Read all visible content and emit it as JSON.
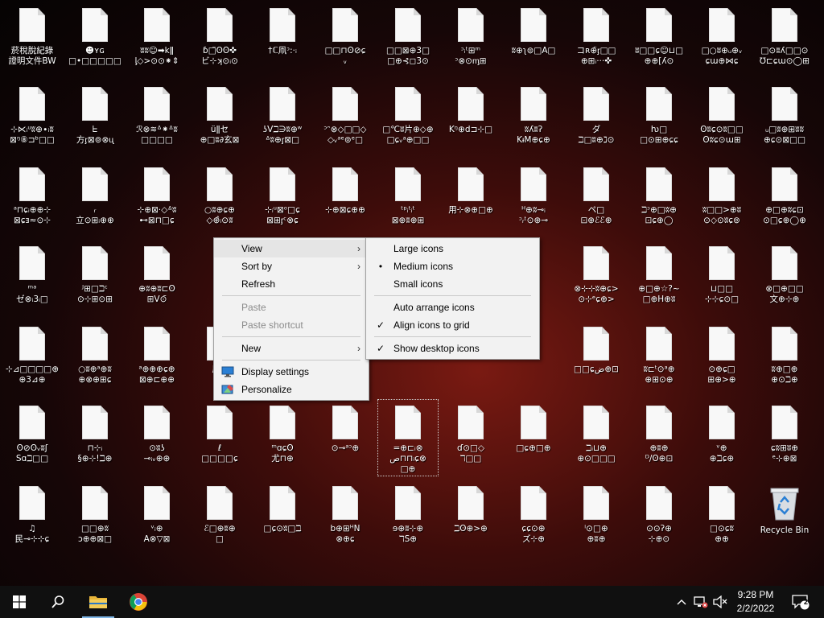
{
  "desktop": {
    "icons": [
      [
        "菸稅脫紀錄\n證明文件BW",
        "☻ʏɢ\n□•□□□□□",
        "ʬʬ☺➡kǁ\nᶅ◇>⊙⊙⁕⇕",
        "ɓ□̈ʘ̄ʘ̃✜\nビ⊹ʞ⊙ᵢ⊙",
        "†ℂ凧ᵓ:⋅ᵢ",
        "□□⊓ʘ̆⊘ɕ\nᵥ",
        "□□⊠⊕3□\n□⊕⊰◻3⊙",
        "ᵓᵢᵗ⊞ᵐ\nᵓ⊗⊙ᶆ⊞",
        "ʬ⊕ʅ⊜□A□",
        "コʀ⊕̈ᶉ□□\n⊕⊞ᵢ⋅⋅⋅✜",
        "ʬ□□ɕ☺⊔□\n⊕⊕[ʎ⊙",
        "□○ʬ⊕ᵤ⊕ᵥ\nɕɯ⊕⋈ɕ",
        "□⊙ʬʎ□□⊙\n℧⊏ɕɯ⊙◯⊞"
      ],
      [
        "⊹⋉ᵢᵘʬ⊕∙ᵢʬ\n⊠ᵑ⑧⊐ᵇ□□",
        "ᖶ\n方ᶉ⊠⊚⊗ᶙ",
        "ℛ⊗≋ᐞ⁕ᐞʬ\n□□□□",
        "ǖǁセ\n⊕□ʬ∂玄⊠",
        "ʖVℶ∋ʬ⊕ʷ\nᐞʬ⊕ᶉ⊠□",
        "ᵓᵔ⊗◇□□◇\n◇ᵥᵃᵉ⊚ᵉ□",
        "□℃ʬ片⊕◇⊕\n□ɕᵥᵃ⊕□□",
        "Kᵑ⊕d⊐⊹□",
        "ʬʎʬʔ\nKᵼM⊕ɕ⊕",
        "ダ\nℶ□ʬ⊕ℷ⊙",
        "ƕ□\n□⊙⊞⊕ɕɕ",
        "ʘʬɕ⊙ʬ□□\nʘʬɕ⊙ɯ⊞",
        "ᵤ□ʬ⊕⊞ʬʬ\n⊕ɕ⊙⊠□□"
      ],
      [
        "ᵃ⊓ɕᵢ⊕⊕⊹\n⊠ɕⱻ≈⊙⊹",
        "ᵣ\n立⊙⊞ᵢ⊕⊕",
        "⊹⊕⊠⋅◇ᐞʬ\n⊷⊠⊓□ɕ",
        "○ʬ⊕ɕ⊕\n◇⊕̂ᵢ⊙ʬ",
        "⊹ᵢᵘ⊠ᵒ□ɕ\n⊠⊞ᶉᶜ⊗ɕ",
        "⊹⊕⊠ɕ⊕⊕",
        "ᵗᵖᵢᵗᵢᵗ\n⊠⊕ʬ⊕⊞",
        "用⊹⊗⊕□⊕",
        "ᴴ⊕ʬ⊸ᵢ\nᵓᵣᵗ⊙⊕⊸",
        "ペ□\n⊡⊕ℰℰ⊕",
        "ℶᵓ⊕□ʬ⊕\n⊡ɕ⊕◯",
        "ʬ□□>⊕ʬ\n⊙◇⊙ʬɕ⊚",
        "⊕□⊕ʬɕ⊡\n⊙□ɕ⊕◯⊕"
      ],
      [
        "ᵐᵃ\nゼ⊗ᵢ3ᵢ□",
        "ᴶ⊞□ℶᶜ\n⊙⊹⊞⊙⊞",
        "⊕ʬ⊕ʬ⊏ʘ\n⊞V⊙̄",
        "",
        "",
        "",
        "",
        "",
        "",
        "⊗⊹⊹ʬ⊕ɕ>\n⊙⊹ᵉɕ⊕>",
        "⊕□⊕☆?~\n□⊕H⊕ʬ",
        "⊔□□\n⊹⊹ɕ⊙□",
        "⊗□⊕□□\n文⊕⊹⊕"
      ],
      [
        "⊹⊿□□□□⊕\n⊕3⊿⊕",
        "○ʬ⊕ᵃ⊕ʬ\n⊕⊗⊕⊞ɕ",
        "ᵃ⊕⊕⊕ɕ⊕\n⊠⊕⊏⊕⊕",
        "厂⊠\nᵤ",
        "",
        "",
        "",
        "",
        "",
        "□□ɕض⊕⊡",
        "ʬ⊏ᵗ⊙ᵃ⊕\n⊕⊞⊙⊕",
        "⊙⊕ɕ□\n⊞⊕>⊕",
        "ʬ⊕□⊕\n⊕⊙ℶ⊕"
      ],
      [
        "ʘ⊘ʘᵥʬʃ\nSɑℶ□□",
        "⊓⊹ᵢ\n§⊕⊹!ℶ⊕",
        "⊙ʬʖ\n⊸ᵢᵥ⊕⊕",
        "ℓ\n□□□□ɕ",
        "ᵐɑɕʘ\n尤⊓⊕",
        "⊙⊸ᵃᵓ⊕",
        "=⊕⊏ᵢ⊗\nص⊓⊓ᵢɕ⊗\n□⊕",
        "ɗ⊙□◇\nℸ□□",
        "□ɕ⊕□⊕",
        "ℶᵢ⊔⊕\n⊕⊙□□□",
        "⊕ʬ⊕\nᴰ/ʘ⊕⊡",
        "ᵛ⊕\n⊕ℶɕ⊕",
        "ɕʬ⊞ʬ⊕\nᵉ⊹⊕⊠"
      ],
      [
        "♫\n民⊸⊹⊹ɕ",
        "□□⊕ʬ\nɔ⊕⊕⊠□",
        "ᵛᵢ⊕\nA⊗▽⊠",
        "ℰ□⊕ʬ⊕\n□",
        "□ɕ⊙ʬ□ℶ",
        "b⊕⊞ᴴN\n⊗⊕ɕ",
        "ɘ⊕ʬ⊹⊕\nℸS⊕",
        "ℶʘ⊕>⊕",
        "ɕɕ⊙⊕\nズ⊹⊕",
        "ⁱ⊙□⊕\n⊕ʬ⊕",
        "⊙⊙ʔ⊕\n⊹⊕⊙",
        "□⊙ɕʬ\n⊕⊕",
        "Recycle Bin"
      ]
    ]
  },
  "context_menu": {
    "items": [
      {
        "label": "View",
        "submenu": true,
        "highlighted": true
      },
      {
        "label": "Sort by",
        "submenu": true
      },
      {
        "label": "Refresh"
      },
      {
        "label": "Paste",
        "disabled": true
      },
      {
        "label": "Paste shortcut",
        "disabled": true
      },
      {
        "label": "New",
        "submenu": true
      },
      {
        "label": "Display settings",
        "icon": "display-icon"
      },
      {
        "label": "Personalize",
        "icon": "personalize-icon"
      }
    ]
  },
  "view_submenu": {
    "items": [
      {
        "label": "Large icons"
      },
      {
        "label": "Medium icons",
        "mark": "•"
      },
      {
        "label": "Small icons"
      },
      {
        "label": "Auto arrange icons"
      },
      {
        "label": "Align icons to grid",
        "mark": "✓"
      },
      {
        "label": "Show desktop icons",
        "mark": "✓"
      }
    ]
  },
  "taskbar": {
    "clock_time": "9:28 PM",
    "clock_date": "2/2/2022",
    "notification_count": "2"
  },
  "colors": {
    "taskbar": "#101010",
    "menu_bg": "#f2f2f2",
    "accent": "#7fb6e6"
  }
}
